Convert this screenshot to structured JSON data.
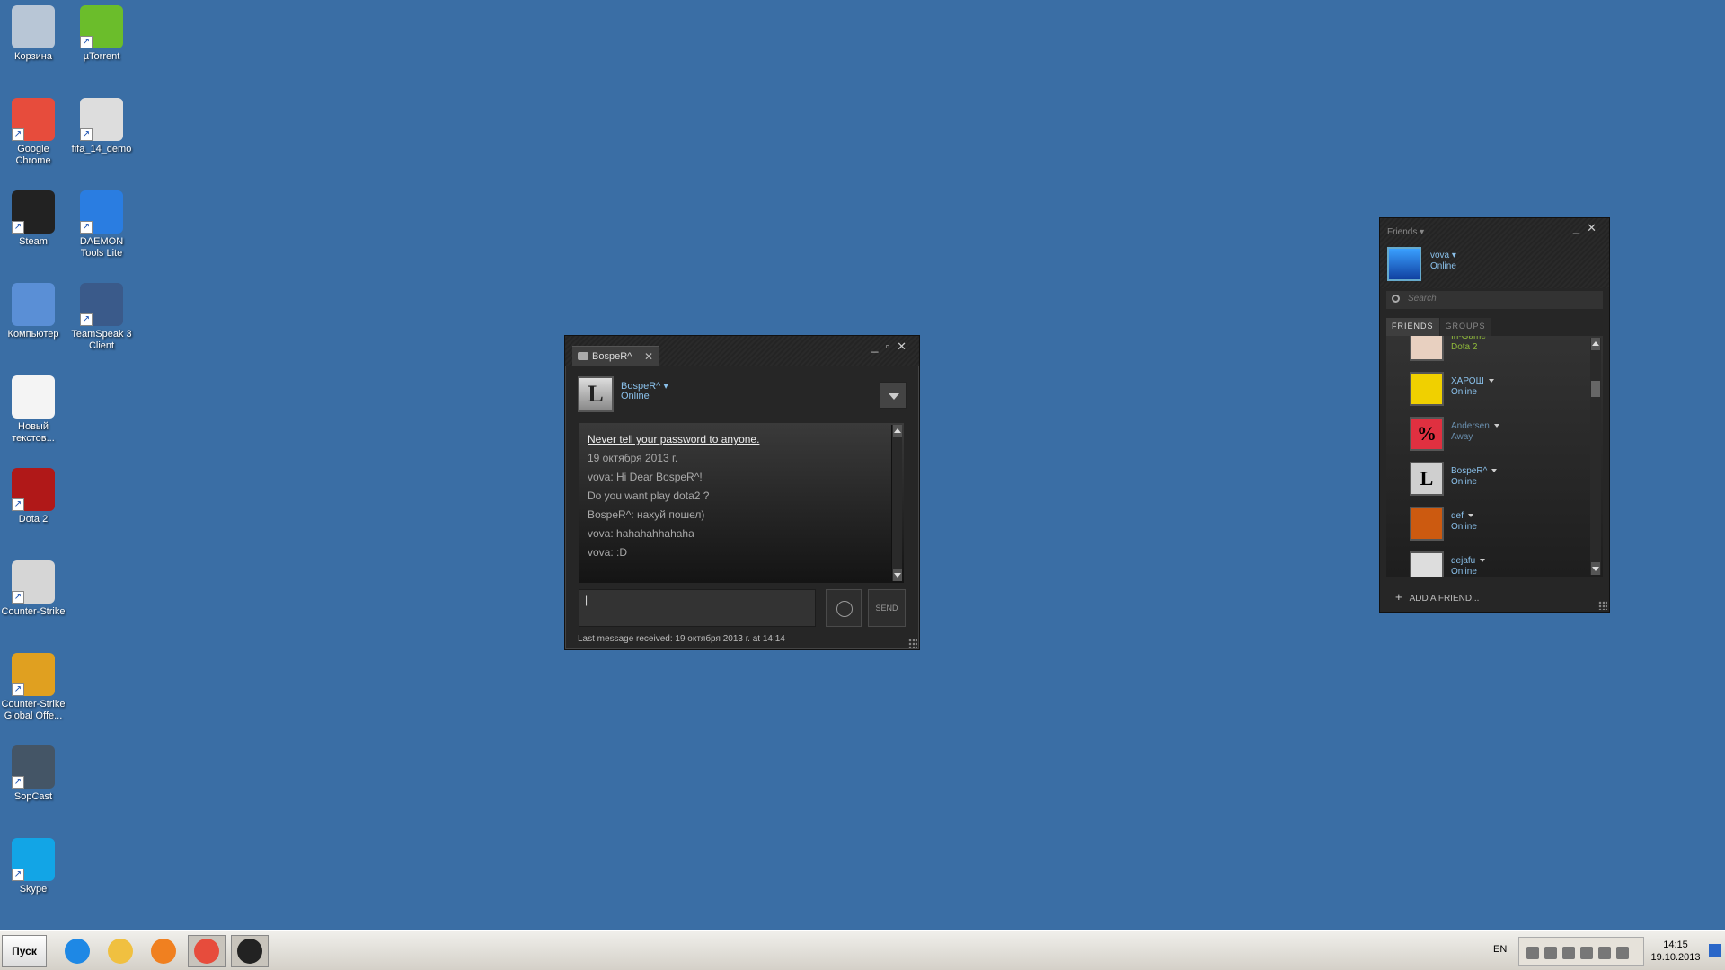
{
  "desktop": {
    "icons": [
      {
        "label": "Корзина",
        "icon": "recycle-bin-icon",
        "color": "#b8c6d6"
      },
      {
        "label": "µTorrent",
        "icon": "utorrent-icon",
        "color": "#6bbd2b"
      },
      {
        "label": "Google Chrome",
        "icon": "chrome-icon",
        "color": "#e74c3c"
      },
      {
        "label": "fifa_14_demo",
        "icon": "disc-image-icon",
        "color": "#dddddd"
      },
      {
        "label": "Steam",
        "icon": "steam-icon",
        "color": "#222222"
      },
      {
        "label": "DAEMON Tools Lite",
        "icon": "daemon-tools-icon",
        "color": "#2a7de1"
      },
      {
        "label": "Компьютер",
        "icon": "computer-icon",
        "color": "#5a8fd6"
      },
      {
        "label": "TeamSpeak 3 Client",
        "icon": "teamspeak-icon",
        "color": "#3a5a8a"
      },
      {
        "label": "Новый текстов...",
        "icon": "text-file-icon",
        "color": "#f4f4f4"
      },
      {
        "label": "Dota 2",
        "icon": "dota2-icon",
        "color": "#b01818"
      },
      {
        "label": "Counter-Strike",
        "icon": "counter-strike-icon",
        "color": "#d6d6d6"
      },
      {
        "label": "Counter-Strike Global Offe...",
        "icon": "csgo-icon",
        "color": "#e0a020"
      },
      {
        "label": "SopCast",
        "icon": "sopcast-icon",
        "color": "#445566"
      },
      {
        "label": "Skype",
        "icon": "skype-icon",
        "color": "#12a5e6"
      }
    ]
  },
  "chat": {
    "tab_label": "BospeR^",
    "friend_name": "BospeR^",
    "friend_status": "Online",
    "avatar_letter": "L",
    "messages": [
      "Never tell your password to anyone.",
      "19 октября 2013 г.",
      "vova: Hi Dear BospeR^!",
      "Do you want play dota2 ?",
      "BospeR^: нахуй пошел)",
      "vova: hahahahhahaha",
      "vova: :D"
    ],
    "input_value": "",
    "send_label": "SEND",
    "footer": "Last message received: 19 октября 2013 г. at 14:14"
  },
  "friends": {
    "title": "Friends",
    "me_name": "vova",
    "me_status": "Online",
    "search_placeholder": "Search",
    "tabs": [
      "FRIENDS",
      "GROUPS"
    ],
    "list": [
      {
        "name": "In-Game",
        "status": "Dota 2",
        "state": "ingame",
        "avatar_color": "#e8d0c0",
        "glyph": ""
      },
      {
        "name": "ХАРОШ",
        "status": "Online",
        "state": "online",
        "avatar_color": "#f0d000",
        "glyph": "",
        "caret": true
      },
      {
        "name": "Andersen",
        "status": "Away",
        "state": "away",
        "avatar_color": "#e03040",
        "glyph": "%",
        "caret": true
      },
      {
        "name": "BospeR^",
        "status": "Online",
        "state": "online",
        "avatar_color": "#cfcfcf",
        "glyph": "L",
        "caret": true
      },
      {
        "name": "def",
        "status": "Online",
        "state": "online",
        "avatar_color": "#cc5a10",
        "glyph": "",
        "caret": true
      },
      {
        "name": "dejafu",
        "status": "Online",
        "state": "online",
        "avatar_color": "#dddddd",
        "glyph": "",
        "caret": true
      }
    ],
    "add_friend_label": "ADD A FRIEND..."
  },
  "taskbar": {
    "start_label": "Пуск",
    "buttons": [
      {
        "name": "ie",
        "color": "#1e88e5"
      },
      {
        "name": "explorer",
        "color": "#f0c040"
      },
      {
        "name": "media-player",
        "color": "#f08020"
      },
      {
        "name": "chrome",
        "color": "#e74c3c"
      },
      {
        "name": "steam",
        "color": "#222222"
      }
    ],
    "language": "EN",
    "time": "14:15",
    "date": "19.10.2013"
  }
}
